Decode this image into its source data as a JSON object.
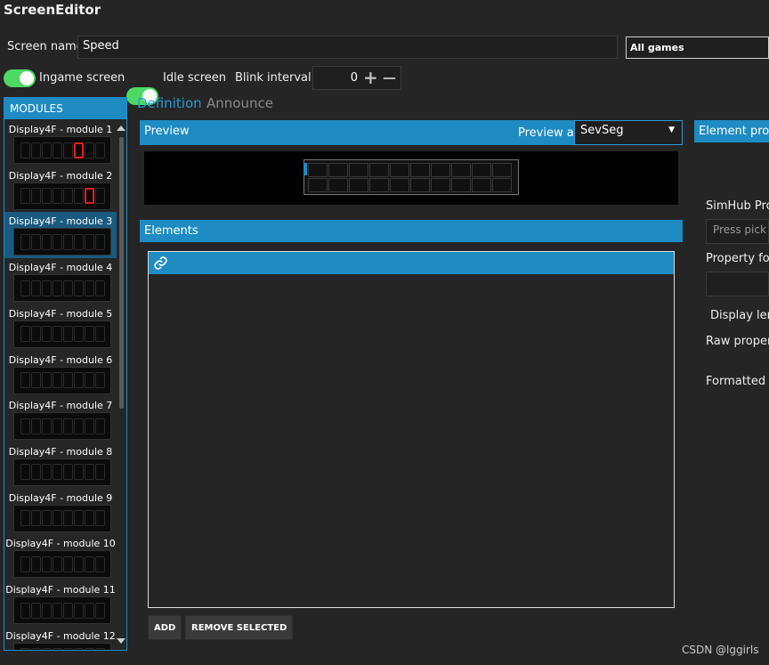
{
  "app": {
    "title": "ScreenEditor"
  },
  "screen": {
    "name_label": "Screen name",
    "name_value": "Speed",
    "games_value": "All games"
  },
  "options": {
    "ingame_label": "Ingame screen",
    "ingame_on": true,
    "idle_label": "Idle screen",
    "idle_on": true,
    "blink_label": "Blink interval",
    "blink_value": "0",
    "plus_glyph": "+",
    "minus_glyph": "—"
  },
  "modules": {
    "header": "MODULES",
    "items": [
      {
        "label": "Display4F - module 1",
        "lit_digit": 5
      },
      {
        "label": "Display4F - module 2",
        "lit_digit": 6
      },
      {
        "label": "Display4F - module 3",
        "selected": true
      },
      {
        "label": "Display4F - module 4"
      },
      {
        "label": "Display4F - module 5"
      },
      {
        "label": "Display4F - module 6"
      },
      {
        "label": "Display4F - module 7"
      },
      {
        "label": "Display4F - module 8"
      },
      {
        "label": "Display4F - module 9"
      },
      {
        "label": "Display4F - module 10"
      },
      {
        "label": "Display4F - module 11"
      },
      {
        "label": "Display4F - module 12"
      }
    ],
    "scroll_up_icon": "triangle-up-icon",
    "scroll_down_icon": "triangle-down-icon"
  },
  "tabs": [
    {
      "label": "Definition",
      "active": true
    },
    {
      "label": "Announce",
      "active": false
    }
  ],
  "preview": {
    "title": "Preview",
    "preview_as_label": "Preview as",
    "preview_as_value": "SevSeg"
  },
  "elements": {
    "title": "Elements",
    "link_icon": "link-icon",
    "add_label": "ADD",
    "remove_label": "REMOVE SELECTED"
  },
  "element_properties": {
    "title": "Element prope",
    "simhub_label": "SimHub Prop",
    "pick_placeholder": "Press pick to",
    "format_label": "Property form",
    "display_length_label": "Display leng",
    "raw_label": "Raw propert",
    "formatted_label": "Formatted p"
  },
  "colors": {
    "accent": "#1e8bc3",
    "toggle_on": "#4cd964",
    "segment_on": "#e0201a",
    "background": "#252526"
  },
  "watermark": "CSDN @lggirls"
}
